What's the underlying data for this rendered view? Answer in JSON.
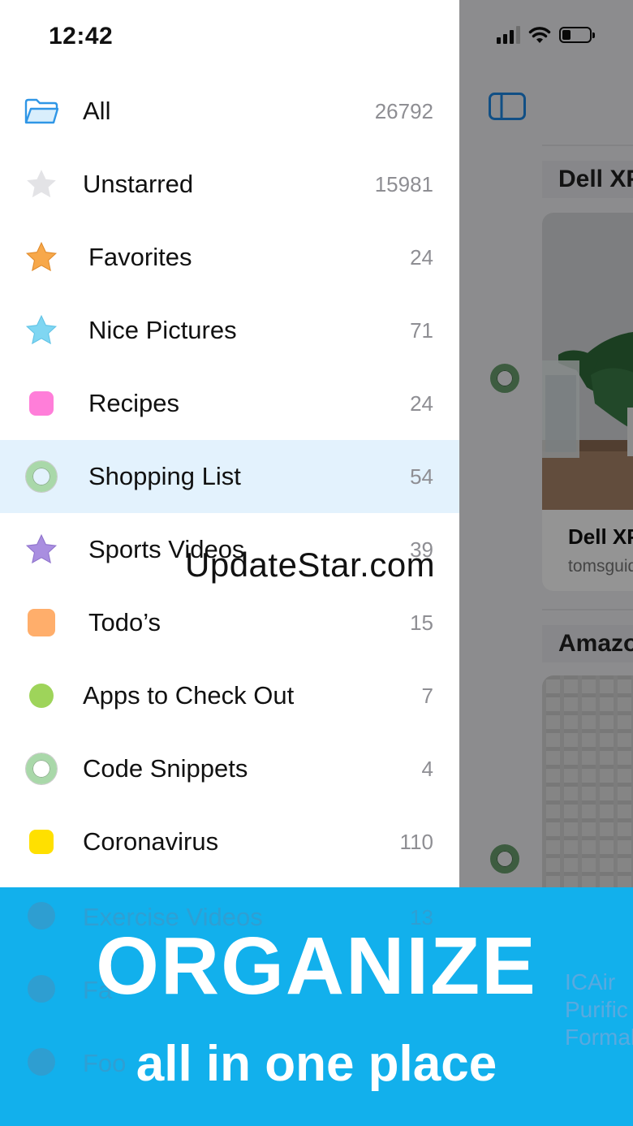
{
  "status_bar": {
    "time": "12:42"
  },
  "collections": [
    {
      "label": "All",
      "count": "26792",
      "icon": "folder-icon"
    },
    {
      "label": "Unstarred",
      "count": "15981",
      "icon": "gray-star-icon"
    },
    {
      "label": "Favorites",
      "count": "24",
      "icon": "orange-star-icon"
    },
    {
      "label": "Nice Pictures",
      "count": "71",
      "icon": "cyan-star-icon"
    },
    {
      "label": "Recipes",
      "count": "24",
      "icon": "pink-square-icon"
    },
    {
      "label": "Shopping List",
      "count": "54",
      "icon": "green-ring-icon",
      "selected": true
    },
    {
      "label": "Sports Videos",
      "count": "39",
      "icon": "purple-star-icon"
    },
    {
      "label": "Todo’s",
      "count": "15",
      "icon": "orange-square-icon"
    },
    {
      "label": "Apps to Check Out",
      "count": "7",
      "icon": "green-dot-icon"
    },
    {
      "label": "Code Snippets",
      "count": "4",
      "icon": "green-ring-icon"
    },
    {
      "label": "Coronavirus",
      "count": "110",
      "icon": "yellow-square-icon"
    }
  ],
  "hidden_rows": [
    {
      "label": "Exercise Videos",
      "count": "13"
    },
    {
      "label": "Fa",
      "count": ""
    },
    {
      "label": "Foo",
      "count": ""
    }
  ],
  "content_panel": {
    "section1_title": "Dell XPS",
    "card1_title": "Dell XPS",
    "card1_source": "tomsguide",
    "section2_title": "Amazon",
    "peek_text": [
      "ICAir",
      "Purific",
      "Formal"
    ]
  },
  "watermark": "UpdateStar.com",
  "banner": {
    "headline": "ORGANIZE",
    "subline": "all in one place"
  },
  "colors": {
    "banner_bg": "#12b0ec",
    "selected_row": "#e3f2fd",
    "count_text": "#8e8e93"
  }
}
